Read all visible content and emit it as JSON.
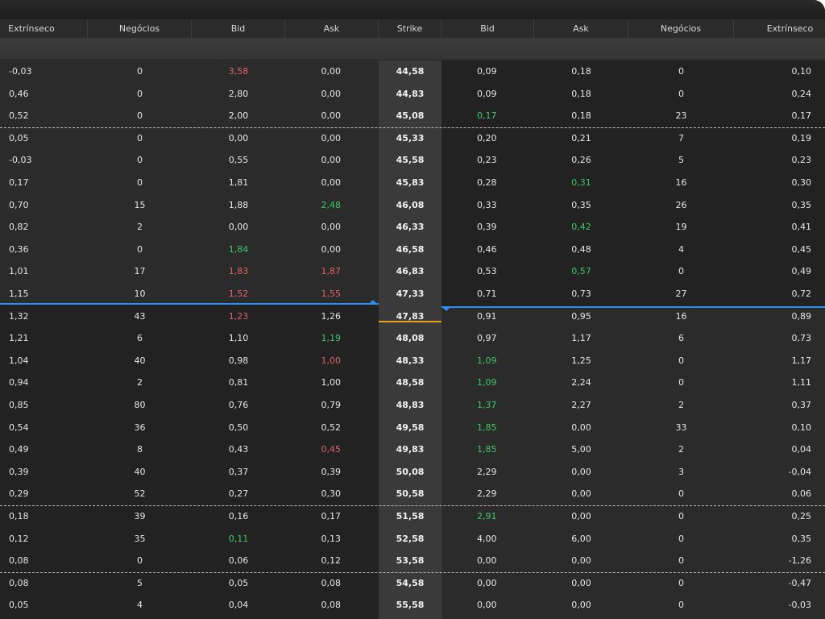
{
  "columns": [
    "Extrínseco",
    "Negócios",
    "Bid",
    "Ask",
    "Strike",
    "Bid",
    "Ask",
    "Negócios",
    "Extrínseco"
  ],
  "rows": [
    {
      "c": [
        "-0,03",
        "0",
        "3,58",
        "0,00",
        "44,58",
        "0,09",
        "0,18",
        "0",
        "0,10"
      ],
      "col": {
        "2": "red"
      }
    },
    {
      "c": [
        "0,46",
        "0",
        "2,80",
        "0,00",
        "44,83",
        "0,09",
        "0,18",
        "0",
        "0,24"
      ],
      "col": {}
    },
    {
      "c": [
        "0,52",
        "0",
        "2,00",
        "0,00",
        "45,08",
        "0,17",
        "0,18",
        "23",
        "0,17"
      ],
      "col": {
        "5": "green"
      }
    },
    {
      "c": [
        "0,05",
        "0",
        "0,00",
        "0,00",
        "45,33",
        "0,20",
        "0,21",
        "7",
        "0,19"
      ],
      "col": {}
    },
    {
      "c": [
        "-0,03",
        "0",
        "0,55",
        "0,00",
        "45,58",
        "0,23",
        "0,26",
        "5",
        "0,23"
      ],
      "col": {}
    },
    {
      "c": [
        "0,17",
        "0",
        "1,81",
        "0,00",
        "45,83",
        "0,28",
        "0,31",
        "16",
        "0,30"
      ],
      "col": {
        "6": "green"
      }
    },
    {
      "c": [
        "0,70",
        "15",
        "1,88",
        "2,48",
        "46,08",
        "0,33",
        "0,35",
        "26",
        "0,35"
      ],
      "col": {
        "3": "green"
      }
    },
    {
      "c": [
        "0,82",
        "2",
        "0,00",
        "0,00",
        "46,33",
        "0,39",
        "0,42",
        "19",
        "0,41"
      ],
      "col": {
        "6": "green"
      }
    },
    {
      "c": [
        "0,36",
        "0",
        "1,84",
        "0,00",
        "46,58",
        "0,46",
        "0,48",
        "4",
        "0,45"
      ],
      "col": {
        "2": "green"
      }
    },
    {
      "c": [
        "1,01",
        "17",
        "1,83",
        "1,87",
        "46,83",
        "0,53",
        "0,57",
        "0",
        "0,49"
      ],
      "col": {
        "2": "red",
        "3": "red",
        "6": "green"
      }
    },
    {
      "c": [
        "1,15",
        "10",
        "1,52",
        "1,55",
        "47,33",
        "0,71",
        "0,73",
        "27",
        "0,72"
      ],
      "col": {
        "2": "red",
        "3": "red"
      }
    },
    {
      "c": [
        "1,32",
        "43",
        "1,23",
        "1,26",
        "47,83",
        "0,91",
        "0,95",
        "16",
        "0,89"
      ],
      "col": {
        "2": "red"
      }
    },
    {
      "c": [
        "1,21",
        "6",
        "1,10",
        "1,19",
        "48,08",
        "0,97",
        "1,17",
        "6",
        "0,73"
      ],
      "col": {
        "3": "green"
      }
    },
    {
      "c": [
        "1,04",
        "40",
        "0,98",
        "1,00",
        "48,33",
        "1,09",
        "1,25",
        "0",
        "1,17"
      ],
      "col": {
        "3": "red",
        "5": "green"
      }
    },
    {
      "c": [
        "0,94",
        "2",
        "0,81",
        "1,00",
        "48,58",
        "1,09",
        "2,24",
        "0",
        "1,11"
      ],
      "col": {
        "5": "green"
      }
    },
    {
      "c": [
        "0,85",
        "80",
        "0,76",
        "0,79",
        "48,83",
        "1,37",
        "2,27",
        "2",
        "0,37"
      ],
      "col": {
        "5": "green"
      }
    },
    {
      "c": [
        "0,54",
        "36",
        "0,50",
        "0,52",
        "49,58",
        "1,85",
        "0,00",
        "33",
        "0,10"
      ],
      "col": {
        "5": "green"
      }
    },
    {
      "c": [
        "0,49",
        "8",
        "0,43",
        "0,45",
        "49,83",
        "1,85",
        "5,00",
        "2",
        "0,04"
      ],
      "col": {
        "3": "red",
        "5": "green"
      }
    },
    {
      "c": [
        "0,39",
        "40",
        "0,37",
        "0,39",
        "50,08",
        "2,29",
        "0,00",
        "3",
        "-0,04"
      ],
      "col": {}
    },
    {
      "c": [
        "0,29",
        "52",
        "0,27",
        "0,30",
        "50,58",
        "2,29",
        "0,00",
        "0",
        "0,06"
      ],
      "col": {}
    },
    {
      "c": [
        "0,18",
        "39",
        "0,16",
        "0,17",
        "51,58",
        "2,91",
        "0,00",
        "0",
        "0,25"
      ],
      "col": {
        "5": "green"
      }
    },
    {
      "c": [
        "0,12",
        "35",
        "0,11",
        "0,13",
        "52,58",
        "4,00",
        "6,00",
        "0",
        "0,35"
      ],
      "col": {
        "2": "green"
      }
    },
    {
      "c": [
        "0,08",
        "0",
        "0,06",
        "0,12",
        "53,58",
        "0,00",
        "0,00",
        "0",
        "-1,26"
      ],
      "col": {}
    },
    {
      "c": [
        "0,08",
        "5",
        "0,05",
        "0,08",
        "54,58",
        "0,00",
        "0,00",
        "0",
        "-0,47"
      ],
      "col": {}
    },
    {
      "c": [
        "0,05",
        "4",
        "0,04",
        "0,08",
        "55,58",
        "0,00",
        "0,00",
        "0",
        "-0,03"
      ],
      "col": {}
    }
  ],
  "colors": {
    "red": "#e0636b",
    "green": "#3fc966",
    "blue_marker": "#2f8ff0",
    "orange_marker": "#e8a21c"
  }
}
